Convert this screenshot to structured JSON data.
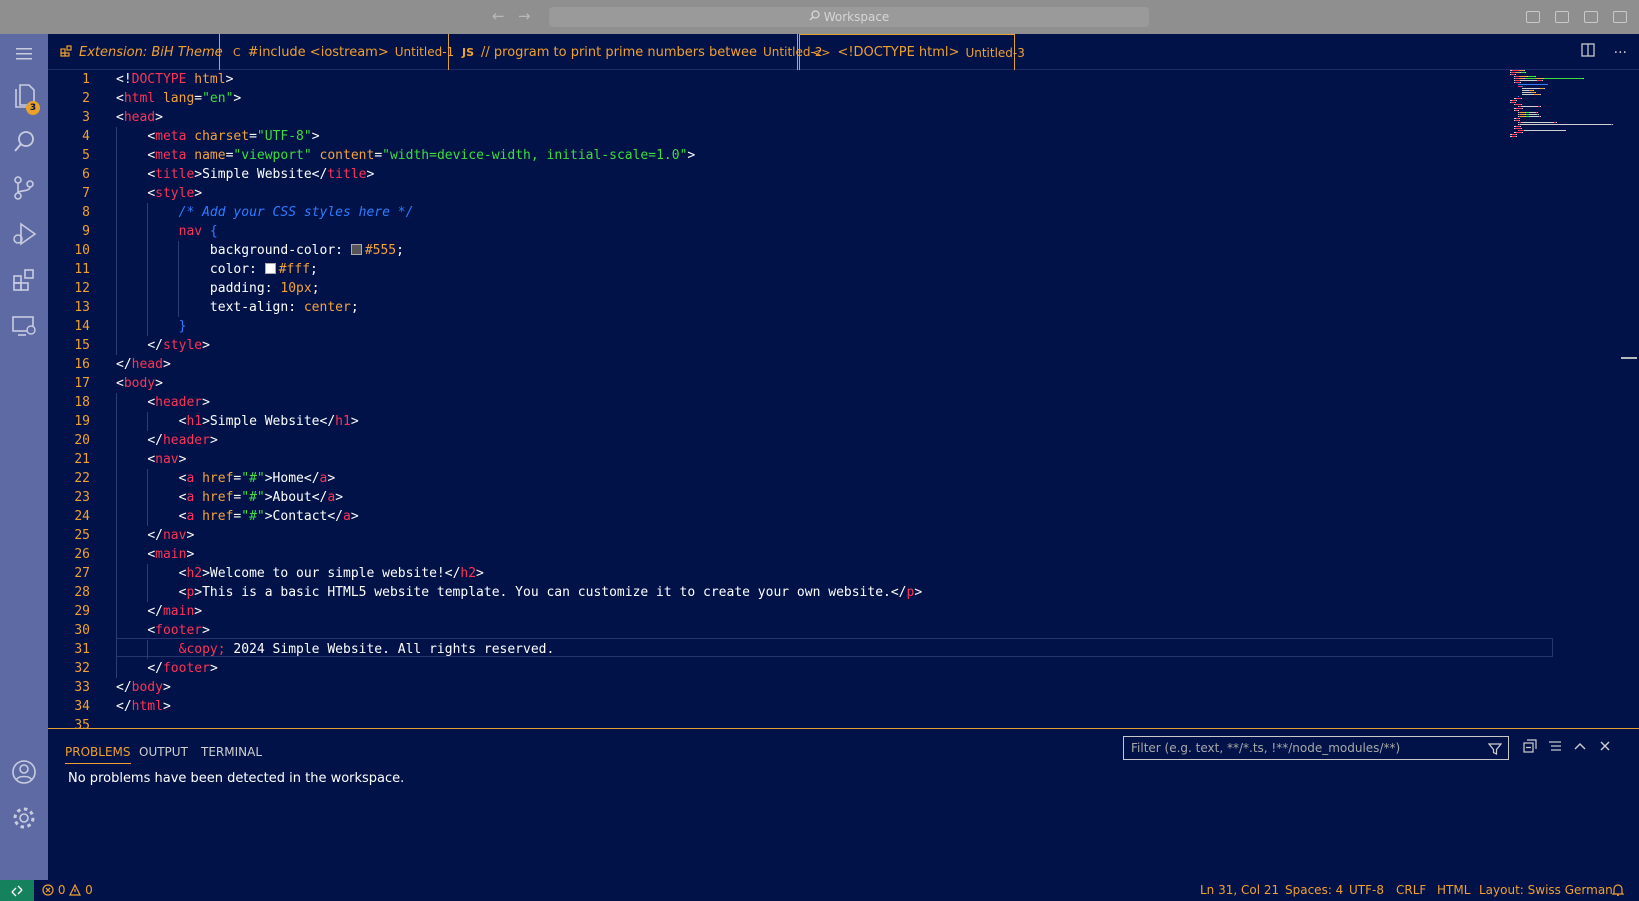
{
  "titlebar": {
    "search_placeholder": "Workspace"
  },
  "activity": {
    "explorer_badge": "3"
  },
  "tabs": [
    {
      "icon": "",
      "label": "Extension: BiH Theme",
      "desc": "",
      "dirty": false
    },
    {
      "icon": "C",
      "label": "#include <iostream>",
      "desc": "Untitled-1",
      "dirty": true
    },
    {
      "icon": "JS",
      "label": "// program to print prime numbers betwee",
      "desc": "Untitled-2",
      "dirty": true
    },
    {
      "icon": "<>",
      "label": "<!DOCTYPE html>",
      "desc": "Untitled-3",
      "dirty": true
    }
  ],
  "active_tab": 3,
  "editor": {
    "current_line": 31,
    "lines": [
      {
        "n": "1",
        "indent": 0,
        "segs": [
          [
            "p",
            "<!"
          ],
          [
            "dt",
            "DOCTYPE"
          ],
          [
            "attr",
            " html"
          ],
          [
            "p",
            ">"
          ]
        ]
      },
      {
        "n": "2",
        "indent": 0,
        "segs": [
          [
            "p",
            "<"
          ],
          [
            "tag",
            "html"
          ],
          [
            "attr",
            " lang"
          ],
          [
            "p",
            "="
          ],
          [
            "str",
            "\"en\""
          ],
          [
            "p",
            ">"
          ]
        ]
      },
      {
        "n": "3",
        "indent": 0,
        "segs": [
          [
            "p",
            "<"
          ],
          [
            "tag",
            "head"
          ],
          [
            "p",
            ">"
          ]
        ]
      },
      {
        "n": "4",
        "indent": 1,
        "segs": [
          [
            "p",
            "<"
          ],
          [
            "tag",
            "meta"
          ],
          [
            "attr",
            " charset"
          ],
          [
            "p",
            "="
          ],
          [
            "str",
            "\"UTF-8\""
          ],
          [
            "p",
            ">"
          ]
        ]
      },
      {
        "n": "5",
        "indent": 1,
        "segs": [
          [
            "p",
            "<"
          ],
          [
            "tag",
            "meta"
          ],
          [
            "attr",
            " name"
          ],
          [
            "p",
            "="
          ],
          [
            "str",
            "\"viewport\""
          ],
          [
            "attr",
            " content"
          ],
          [
            "p",
            "="
          ],
          [
            "str",
            "\"width=device-width, initial-scale=1.0\""
          ],
          [
            "p",
            ">"
          ]
        ]
      },
      {
        "n": "6",
        "indent": 1,
        "segs": [
          [
            "p",
            "<"
          ],
          [
            "tag",
            "title"
          ],
          [
            "p",
            ">Simple Website</"
          ],
          [
            "tag",
            "title"
          ],
          [
            "p",
            ">"
          ]
        ]
      },
      {
        "n": "7",
        "indent": 1,
        "segs": [
          [
            "p",
            "<"
          ],
          [
            "tag",
            "style"
          ],
          [
            "p",
            ">"
          ]
        ]
      },
      {
        "n": "8",
        "indent": 2,
        "segs": [
          [
            "com",
            "/* Add your CSS styles here */"
          ]
        ]
      },
      {
        "n": "9",
        "indent": 2,
        "segs": [
          [
            "sel",
            "nav"
          ],
          [
            "br",
            " {"
          ]
        ]
      },
      {
        "n": "10",
        "indent": 3,
        "segs": [
          [
            "p",
            "background-color: "
          ],
          [
            "sw",
            "#555555"
          ],
          [
            "val",
            "#555"
          ],
          [
            "p",
            ";"
          ]
        ]
      },
      {
        "n": "11",
        "indent": 3,
        "segs": [
          [
            "p",
            "color: "
          ],
          [
            "sw",
            "#ffffff"
          ],
          [
            "val",
            "#fff"
          ],
          [
            "p",
            ";"
          ]
        ]
      },
      {
        "n": "12",
        "indent": 3,
        "segs": [
          [
            "p",
            "padding: "
          ],
          [
            "val",
            "10px"
          ],
          [
            "p",
            ";"
          ]
        ]
      },
      {
        "n": "13",
        "indent": 3,
        "segs": [
          [
            "p",
            "text-align: "
          ],
          [
            "val",
            "center"
          ],
          [
            "p",
            ";"
          ]
        ]
      },
      {
        "n": "14",
        "indent": 2,
        "segs": [
          [
            "br",
            "}"
          ]
        ]
      },
      {
        "n": "15",
        "indent": 1,
        "segs": [
          [
            "p",
            "</"
          ],
          [
            "tag",
            "style"
          ],
          [
            "p",
            ">"
          ]
        ]
      },
      {
        "n": "16",
        "indent": 0,
        "segs": [
          [
            "p",
            "</"
          ],
          [
            "tag",
            "head"
          ],
          [
            "p",
            ">"
          ]
        ]
      },
      {
        "n": "17",
        "indent": 0,
        "segs": [
          [
            "p",
            "<"
          ],
          [
            "tag",
            "body"
          ],
          [
            "p",
            ">"
          ]
        ]
      },
      {
        "n": "18",
        "indent": 1,
        "segs": [
          [
            "p",
            "<"
          ],
          [
            "tag",
            "header"
          ],
          [
            "p",
            ">"
          ]
        ]
      },
      {
        "n": "19",
        "indent": 2,
        "segs": [
          [
            "p",
            "<"
          ],
          [
            "tag",
            "h1"
          ],
          [
            "p",
            ">Simple Website</"
          ],
          [
            "tag",
            "h1"
          ],
          [
            "p",
            ">"
          ]
        ]
      },
      {
        "n": "20",
        "indent": 1,
        "segs": [
          [
            "p",
            "</"
          ],
          [
            "tag",
            "header"
          ],
          [
            "p",
            ">"
          ]
        ]
      },
      {
        "n": "21",
        "indent": 1,
        "segs": [
          [
            "p",
            "<"
          ],
          [
            "tag",
            "nav"
          ],
          [
            "p",
            ">"
          ]
        ]
      },
      {
        "n": "22",
        "indent": 2,
        "segs": [
          [
            "p",
            "<"
          ],
          [
            "tag",
            "a"
          ],
          [
            "attr",
            " href"
          ],
          [
            "p",
            "="
          ],
          [
            "str",
            "\"#\""
          ],
          [
            "p",
            ">Home</"
          ],
          [
            "tag",
            "a"
          ],
          [
            "p",
            ">"
          ]
        ]
      },
      {
        "n": "23",
        "indent": 2,
        "segs": [
          [
            "p",
            "<"
          ],
          [
            "tag",
            "a"
          ],
          [
            "attr",
            " href"
          ],
          [
            "p",
            "="
          ],
          [
            "str",
            "\"#\""
          ],
          [
            "p",
            ">About</"
          ],
          [
            "tag",
            "a"
          ],
          [
            "p",
            ">"
          ]
        ]
      },
      {
        "n": "24",
        "indent": 2,
        "segs": [
          [
            "p",
            "<"
          ],
          [
            "tag",
            "a"
          ],
          [
            "attr",
            " href"
          ],
          [
            "p",
            "="
          ],
          [
            "str",
            "\"#\""
          ],
          [
            "p",
            ">Contact</"
          ],
          [
            "tag",
            "a"
          ],
          [
            "p",
            ">"
          ]
        ]
      },
      {
        "n": "25",
        "indent": 1,
        "segs": [
          [
            "p",
            "</"
          ],
          [
            "tag",
            "nav"
          ],
          [
            "p",
            ">"
          ]
        ]
      },
      {
        "n": "26",
        "indent": 1,
        "segs": [
          [
            "p",
            "<"
          ],
          [
            "tag",
            "main"
          ],
          [
            "p",
            ">"
          ]
        ]
      },
      {
        "n": "27",
        "indent": 2,
        "segs": [
          [
            "p",
            "<"
          ],
          [
            "tag",
            "h2"
          ],
          [
            "p",
            ">Welcome to our simple website!</"
          ],
          [
            "tag",
            "h2"
          ],
          [
            "p",
            ">"
          ]
        ]
      },
      {
        "n": "28",
        "indent": 2,
        "segs": [
          [
            "p",
            "<"
          ],
          [
            "tag",
            "p"
          ],
          [
            "p",
            ">This is a basic HTML5 website template. You can customize it to create your own website.</"
          ],
          [
            "tag",
            "p"
          ],
          [
            "p",
            ">"
          ]
        ]
      },
      {
        "n": "29",
        "indent": 1,
        "segs": [
          [
            "p",
            "</"
          ],
          [
            "tag",
            "main"
          ],
          [
            "p",
            ">"
          ]
        ]
      },
      {
        "n": "30",
        "indent": 1,
        "segs": [
          [
            "p",
            "<"
          ],
          [
            "tag",
            "footer"
          ],
          [
            "p",
            ">"
          ]
        ]
      },
      {
        "n": "31",
        "indent": 2,
        "segs": [
          [
            "ent",
            "&copy;"
          ],
          [
            "p",
            " 2024 Simple Website. All rights reserved."
          ]
        ]
      },
      {
        "n": "32",
        "indent": 1,
        "segs": [
          [
            "p",
            "</"
          ],
          [
            "tag",
            "footer"
          ],
          [
            "p",
            ">"
          ]
        ]
      },
      {
        "n": "33",
        "indent": 0,
        "segs": [
          [
            "p",
            "</"
          ],
          [
            "tag",
            "body"
          ],
          [
            "p",
            ">"
          ]
        ]
      },
      {
        "n": "34",
        "indent": 0,
        "segs": [
          [
            "p",
            "</"
          ],
          [
            "tag",
            "html"
          ],
          [
            "p",
            ">"
          ]
        ]
      },
      {
        "n": "35",
        "indent": 0,
        "segs": []
      }
    ]
  },
  "panel": {
    "tabs": [
      "PROBLEMS",
      "OUTPUT",
      "TERMINAL"
    ],
    "active": 0,
    "filter_placeholder": "Filter (e.g. text, **/*.ts, !**/node_modules/**)",
    "message": "No problems have been detected in the workspace."
  },
  "status": {
    "errors": "0",
    "warnings": "0",
    "position": "Ln 31, Col 21",
    "spaces": "Spaces: 4",
    "encoding": "UTF-8",
    "eol": "CRLF",
    "language": "HTML",
    "layout": "Layout: Swiss German"
  },
  "colors": {
    "background": "#001247",
    "accent": "#f0a030",
    "activity_bar": "#5d6aa3",
    "tag": "#ff3355",
    "string": "#3cde3c",
    "comment": "#2f7cff"
  },
  "icons": [
    "menu-icon",
    "files-icon",
    "search-icon",
    "source-control-icon",
    "run-debug-icon",
    "extensions-icon",
    "remote-explorer-icon",
    "account-icon",
    "settings-gear-icon",
    "split-editor-icon",
    "more-actions-icon",
    "filter-icon",
    "collapse-all-icon",
    "view-as-tree-icon",
    "maximize-panel-icon",
    "close-panel-icon",
    "bell-icon"
  ]
}
